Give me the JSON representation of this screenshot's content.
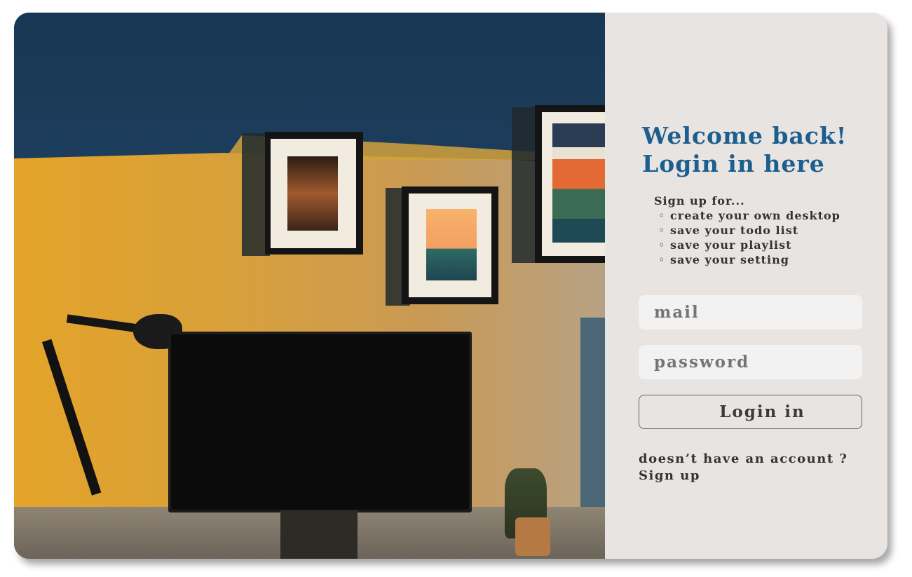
{
  "login": {
    "title_line1": "Welcome back!",
    "title_line2": "Login in here",
    "signup_intro": "Sign up for...",
    "benefits": [
      "create your own desktop",
      "save your todo list",
      "save your playlist",
      "save your setting"
    ],
    "mail_placeholder": "mail",
    "password_placeholder": "password",
    "login_button": "Login in",
    "no_account_text": "doesn’t have an account ?",
    "signup_link": "Sign up"
  },
  "colors": {
    "title": "#1c5e8e",
    "panel_bg": "#e8e4e1",
    "input_bg": "#f2f2f3"
  }
}
